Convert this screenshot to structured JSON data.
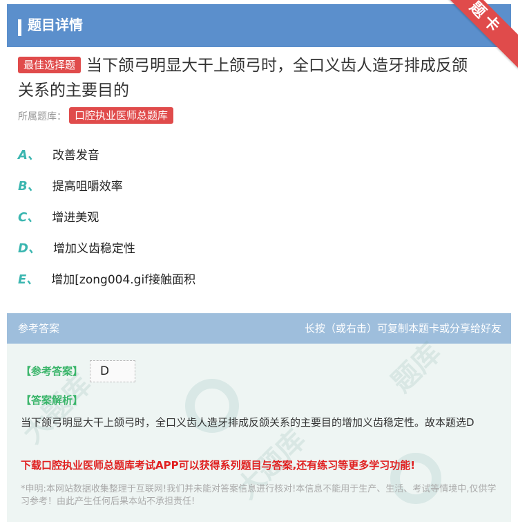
{
  "header": {
    "title": "题目详情",
    "ribbon": "题卡"
  },
  "question": {
    "type_tag": "最佳选择题",
    "text_line1": "当下颌弓明显大干上颌弓时，全口义齿人造牙排成反颌",
    "text_line2": "关系的主要目的",
    "library_label": "所属题库：",
    "library_name": "口腔执业医师总题库"
  },
  "options": [
    {
      "letter": "A、",
      "text": "改善发音"
    },
    {
      "letter": "B、",
      "text": "提高咀嚼效率"
    },
    {
      "letter": "C、",
      "text": "增进美观"
    },
    {
      "letter": "D、",
      "text": "增加义齿稳定性"
    },
    {
      "letter": "E、",
      "text": "增加[zong004.gif接触面积"
    }
  ],
  "answer_section": {
    "title": "参考答案",
    "hint": "长按（或右击）可复制本题卡或分享给好友",
    "ref_label": "【参考答案】",
    "ref_value": "D",
    "analysis_label": "【答案解析】",
    "analysis": "当下颌弓明显大干上颌弓时，全口义齿人造牙排成反颌关系的主要目的增加义齿稳定性。故本题选D",
    "promo": "下载口腔执业医师总题库考试APP可以获得系列题目与答案,还有练习等更多学习功能!",
    "disclaimer": "*申明:本网站数据收集整理于互联网!我们并未能对答案信息进行核对!本信息不能用于生产、生活、考试等情境中,仅供学习参考！由此产生任何后果本站不承担责任!"
  },
  "colors": {
    "header": "#5b8fcc",
    "tag": "#e04b4b",
    "letter": "#3bb6b0",
    "answer_head": "#9ebedc",
    "green": "#3ab56a",
    "promo": "#e02020"
  }
}
